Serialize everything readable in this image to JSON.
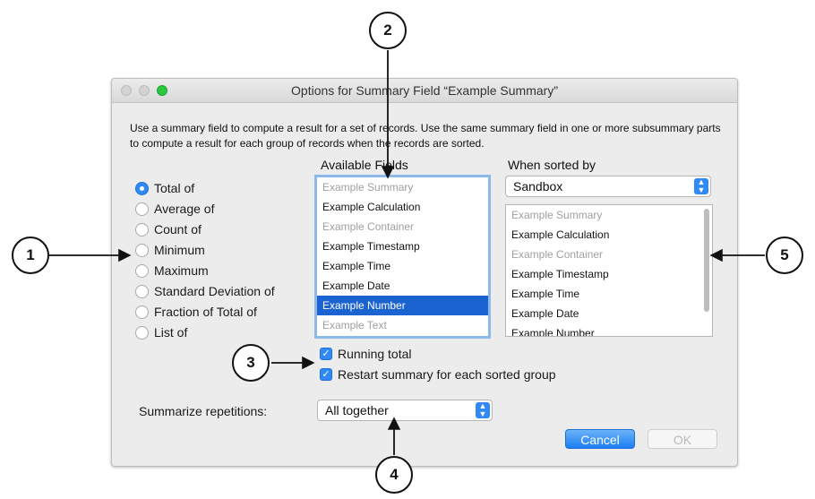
{
  "window": {
    "title": "Options for Summary Field “Example Summary”",
    "description": "Use a summary field to compute a result for a set of records. Use the same summary field in one or more subsummary parts to compute a result for each group of records when the records are sorted."
  },
  "summary_types": [
    {
      "label": "Total of",
      "selected": true
    },
    {
      "label": "Average of",
      "selected": false
    },
    {
      "label": "Count of",
      "selected": false
    },
    {
      "label": "Minimum",
      "selected": false
    },
    {
      "label": "Maximum",
      "selected": false
    },
    {
      "label": "Standard Deviation of",
      "selected": false
    },
    {
      "label": "Fraction of Total of",
      "selected": false
    },
    {
      "label": "List of",
      "selected": false
    }
  ],
  "available_fields": {
    "heading": "Available Fields",
    "items": [
      {
        "label": "Example Summary",
        "state": "dim"
      },
      {
        "label": "Example Calculation",
        "state": "normal"
      },
      {
        "label": "Example Container",
        "state": "dim"
      },
      {
        "label": "Example Timestamp",
        "state": "normal"
      },
      {
        "label": "Example Time",
        "state": "normal"
      },
      {
        "label": "Example Date",
        "state": "normal"
      },
      {
        "label": "Example Number",
        "state": "selected"
      },
      {
        "label": "Example Text",
        "state": "dim"
      }
    ]
  },
  "sorted_by": {
    "heading": "When sorted by",
    "table": "Sandbox",
    "items": [
      {
        "label": "Example Summary",
        "state": "dim"
      },
      {
        "label": "Example Calculation",
        "state": "normal"
      },
      {
        "label": "Example Container",
        "state": "dim"
      },
      {
        "label": "Example Timestamp",
        "state": "normal"
      },
      {
        "label": "Example Time",
        "state": "normal"
      },
      {
        "label": "Example Date",
        "state": "normal"
      },
      {
        "label": "Example Number",
        "state": "normal"
      }
    ]
  },
  "options": {
    "running_total": {
      "label": "Running total",
      "checked": true
    },
    "restart_summary": {
      "label": "Restart summary for each sorted group",
      "checked": true
    }
  },
  "repetitions": {
    "label": "Summarize repetitions:",
    "value": "All together"
  },
  "buttons": {
    "cancel": "Cancel",
    "ok": "OK"
  },
  "callouts": [
    "1",
    "2",
    "3",
    "4",
    "5"
  ],
  "colors": {
    "accent": "#2f8af5",
    "selection": "#1c63d2",
    "close": "#d0d0d0",
    "zoom": "#2bc840"
  }
}
